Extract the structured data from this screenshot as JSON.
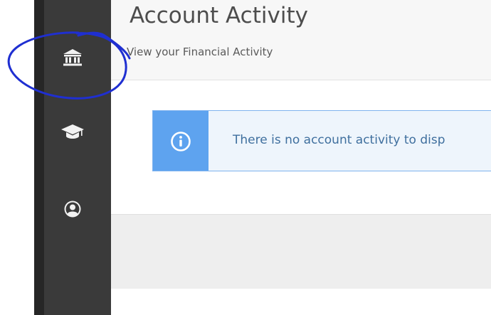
{
  "header": {
    "title": "Account Activity",
    "subtitle": "View your Financial Activity"
  },
  "sidebar": {
    "items": [
      {
        "icon": "bank-icon"
      },
      {
        "icon": "graduation-cap-icon"
      },
      {
        "icon": "user-circle-icon"
      }
    ]
  },
  "alert": {
    "icon": "info-icon",
    "message": "There is no account activity to disp"
  },
  "colors": {
    "sidebar": "#3a3a3a",
    "alert_icon_bg": "#5ea3ef",
    "alert_bg": "#eef5fc",
    "alert_text": "#3f6f9e",
    "annotation": "#1f2fd1"
  }
}
